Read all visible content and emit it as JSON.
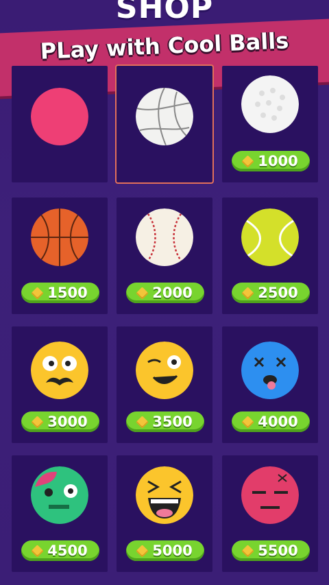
{
  "header": {
    "title": "SHOP",
    "banner": "PLay with Cool Balls"
  },
  "balls": [
    {
      "name": "pink-ball",
      "price": ""
    },
    {
      "name": "volleyball",
      "price": ""
    },
    {
      "name": "golf-ball",
      "price": "1000"
    },
    {
      "name": "basketball",
      "price": "1500"
    },
    {
      "name": "baseball",
      "price": "2000"
    },
    {
      "name": "tennis-ball",
      "price": "2500"
    },
    {
      "name": "mustache-emoji-ball",
      "price": "3000"
    },
    {
      "name": "wink-emoji-ball",
      "price": "3500"
    },
    {
      "name": "dizzy-emoji-ball",
      "price": "4000"
    },
    {
      "name": "zombie-emoji-ball",
      "price": "4500"
    },
    {
      "name": "laughing-emoji-ball",
      "price": "5000"
    },
    {
      "name": "annoyed-emoji-ball",
      "price": "5500"
    }
  ],
  "colors": {
    "background": "#3d1f78",
    "banner": "#c2306a",
    "price_pill": "#78d42f",
    "selected_outline": "#e2705a"
  }
}
